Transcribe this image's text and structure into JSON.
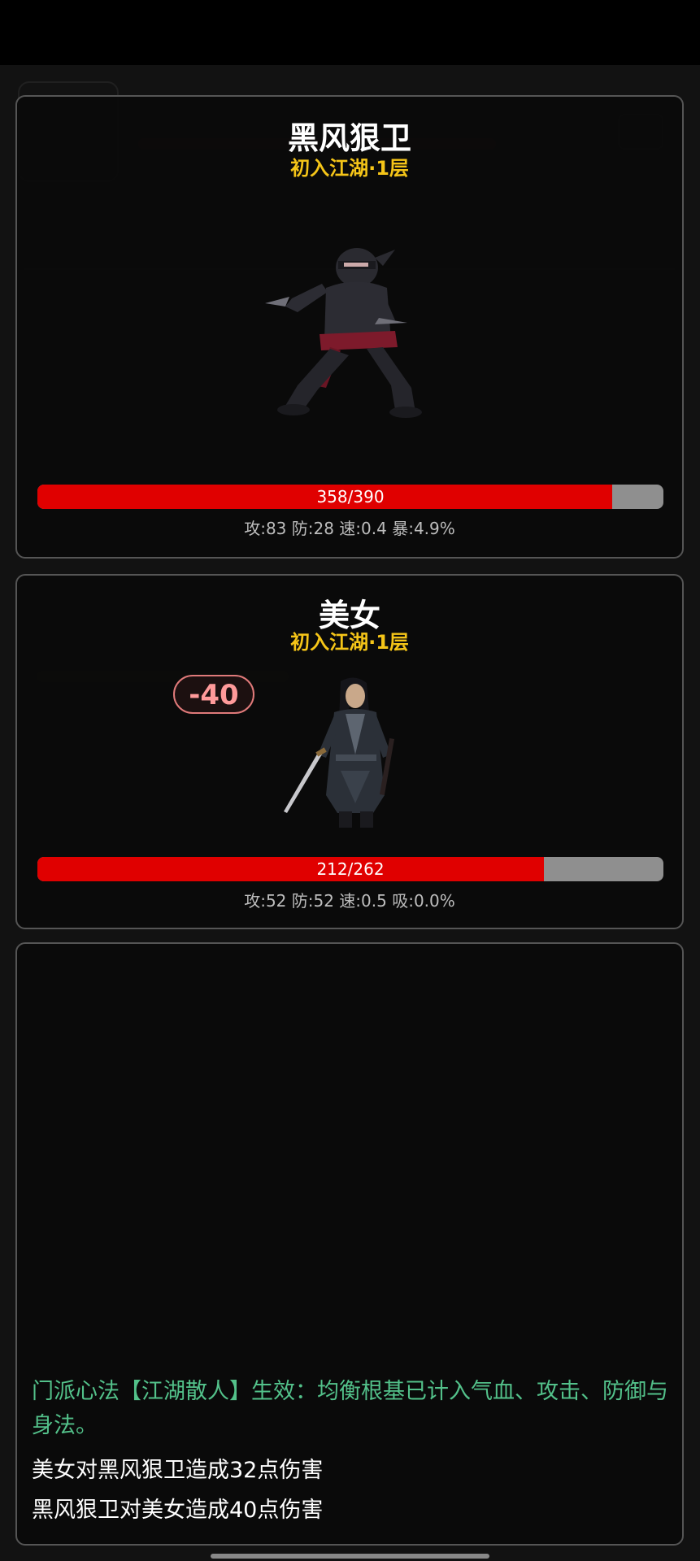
{
  "enemy": {
    "name": "黑风狠卫",
    "realm": "初入江湖·1层",
    "hp_text": "358/390",
    "hp_fraction": 0.918,
    "stats": "攻:83 防:28 速:0.4 暴:4.9%"
  },
  "player": {
    "name": "美女",
    "realm": "初入江湖·1层",
    "hp_text": "212/262",
    "hp_fraction": 0.809,
    "stats": "攻:52 防:52 速:0.5 吸:0.0%",
    "damage_popup": "-40"
  },
  "log": {
    "lines": [
      "门派心法【江湖散人】生效：均衡根基已计入气血、攻击、防御与身法。",
      "美女对黑风狠卫造成32点伤害",
      "黑风狠卫对美女造成40点伤害"
    ]
  },
  "colors": {
    "hp_fill": "#e00000",
    "hp_empty": "#8f8f8f",
    "realm": "#f5c518",
    "log_system": "#53c18a"
  }
}
